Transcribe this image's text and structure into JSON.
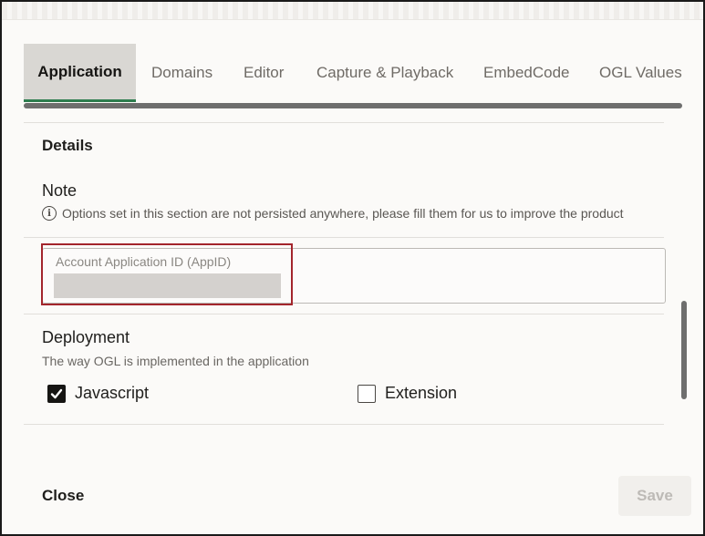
{
  "tabs": [
    {
      "label": "Application",
      "active": true
    },
    {
      "label": "Domains",
      "active": false
    },
    {
      "label": "Editor",
      "active": false
    },
    {
      "label": "Capture & Playback",
      "active": false
    },
    {
      "label": "EmbedCode",
      "active": false
    },
    {
      "label": "OGL Values",
      "active": false
    }
  ],
  "details": {
    "title": "Details",
    "note_title": "Note",
    "info_icon": "info-icon",
    "note_text": "Options set in this section are not persisted anywhere, please fill them for us to improve the product",
    "appid_label": "Account Application ID (AppID)",
    "appid_value": ""
  },
  "deployment": {
    "title": "Deployment",
    "subtitle": "The way OGL is implemented in the application",
    "options": [
      {
        "label": "Javascript",
        "checked": true
      },
      {
        "label": "Extension",
        "checked": false
      }
    ]
  },
  "footer": {
    "close_label": "Close",
    "save_label": "Save"
  },
  "colors": {
    "highlight_border": "#a3252c",
    "active_tab_bg": "#d9d7d3",
    "disabled_text": "#bdbab6"
  }
}
